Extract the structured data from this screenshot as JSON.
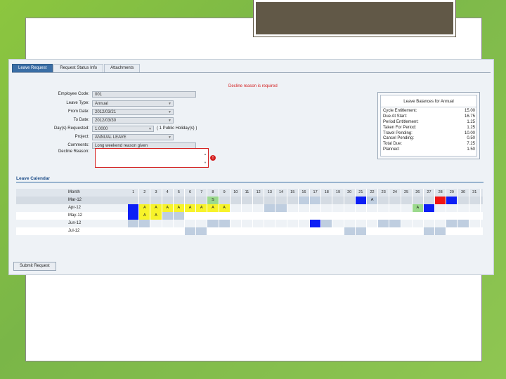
{
  "tabs": [
    "Leave Request",
    "Request Status Info",
    "Attachments"
  ],
  "error_message": "Decline reason is required",
  "form": [
    {
      "label": "Employee Code:",
      "value": "001",
      "type": "text",
      "width": 148
    },
    {
      "label": "Leave Type:",
      "value": "Annual",
      "type": "select",
      "width": 116
    },
    {
      "label": "From Date:",
      "value": "2012/03/21",
      "type": "select",
      "width": 116
    },
    {
      "label": "To Date:",
      "value": "2012/03/30",
      "type": "select",
      "width": 116
    },
    {
      "label": "Day(s) Requested:",
      "value": "1.0000",
      "type": "select",
      "width": 88,
      "extra": "( 1 Public Holiday(s) )"
    },
    {
      "label": "Project:",
      "value": "ANNUAL LEAVE",
      "type": "select",
      "width": 116
    },
    {
      "label": "Comments:",
      "value": "Long weekend reason given",
      "type": "text",
      "width": 148
    }
  ],
  "decline_label": "Decline Reason:",
  "balance": {
    "title": "Leave Balances for Annual",
    "items": [
      {
        "label": "Cycle Entitlement:",
        "value": "15.00"
      },
      {
        "label": "Due At Start:",
        "value": "16.75"
      },
      {
        "label": "Period Entitlement:",
        "value": "1.25"
      },
      {
        "label": "Taken For Period:",
        "value": "1.25"
      },
      {
        "label": "Travel Pending:",
        "value": "10.00"
      },
      {
        "label": "Cancel Pending:",
        "value": "0.50"
      },
      {
        "label": "Total Due:",
        "value": "7.25"
      },
      {
        "label": "Planned:",
        "value": "1.50"
      }
    ]
  },
  "calendar": {
    "title": "Leave Calendar",
    "month_header": "Month",
    "days": [
      "1",
      "2",
      "3",
      "4",
      "5",
      "6",
      "7",
      "8",
      "9",
      "10",
      "11",
      "12",
      "13",
      "14",
      "15",
      "16",
      "17",
      "18",
      "19",
      "20",
      "21",
      "22",
      "23",
      "24",
      "25",
      "26",
      "27",
      "28",
      "29",
      "30",
      "31"
    ],
    "rows": [
      {
        "month": "Mar-12",
        "cells": [
          "",
          "",
          "",
          "",
          "",
          "",
          "",
          "g:S",
          "",
          "",
          "",
          "",
          "",
          "",
          "",
          "h",
          "h",
          "",
          "",
          "",
          "b",
          "h:A",
          "",
          "",
          "",
          "",
          "",
          "r",
          "b",
          "",
          ""
        ]
      },
      {
        "month": "Apr-12",
        "cells": [
          "b",
          "y:A",
          "y:A",
          "y:A",
          "y:A",
          "y:A",
          "y:A",
          "y:A",
          "y:A",
          "",
          "",
          "",
          "h",
          "h",
          "",
          "",
          "",
          "",
          "",
          "",
          "",
          "",
          "",
          "",
          "",
          "g:A",
          "b",
          "",
          "",
          "",
          ""
        ]
      },
      {
        "month": "May-12",
        "cells": [
          "b",
          "y:A",
          "y:A",
          "h",
          "h",
          "",
          "",
          "",
          "",
          "",
          "",
          "",
          "",
          "",
          "",
          "",
          "",
          "",
          "",
          "",
          "",
          "",
          "",
          "",
          "",
          "",
          "",
          "",
          "",
          "",
          ""
        ]
      },
      {
        "month": "Jun-12",
        "cells": [
          "h",
          "h",
          "",
          "",
          "",
          "",
          "",
          "h",
          "h",
          "",
          "",
          "",
          "",
          "",
          "",
          "",
          "b",
          "h",
          "",
          "",
          "",
          "",
          "h",
          "h",
          "",
          "",
          "",
          "",
          "h",
          "h",
          ""
        ]
      },
      {
        "month": "Jul-12",
        "cells": [
          "",
          "",
          "",
          "",
          "",
          "h",
          "h",
          "",
          "",
          "",
          "",
          "",
          "",
          "",
          "",
          "",
          "",
          "",
          "",
          "h",
          "h",
          "",
          "",
          "",
          "",
          "",
          "h",
          "h",
          "",
          "",
          ""
        ]
      }
    ]
  },
  "submit_label": "Submit Request"
}
